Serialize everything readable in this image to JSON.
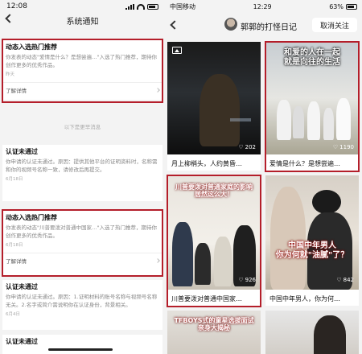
{
  "left": {
    "status_time": "12:08",
    "title": "系统通知",
    "more_text": "以下是更早消息",
    "cards": [
      {
        "title": "动态入选热门推荐",
        "body": "你发表的动态\"爱情是什么？是想尝遍…\"入选了热门推荐，期待你创作更多的优秀作品。",
        "date": "昨天",
        "link": "了解详情"
      },
      {
        "title": "认证未通过",
        "body": "你申请的认证未通过。原因：提供其他平台的证明资料时，名称需和你的视频号名称一致，请修改后再提交。",
        "date": "6月18日",
        "link": ""
      },
      {
        "title": "动态入选热门推荐",
        "body": "你发表的动态\"川普要泼对普通中国家…\"入选了热门推荐，期待你创作更多的优秀作品。",
        "date": "6月18日",
        "link": "了解详情"
      },
      {
        "title": "认证未通过",
        "body": "你申请的认证未通过。原因：1.证明材料的账号名称与视频号名称无关。2.名字或简介需说明你在认证身份，背景相关。",
        "date": "6月4日",
        "link": ""
      },
      {
        "title": "认证未通过",
        "body": "",
        "date": "",
        "link": ""
      }
    ]
  },
  "right": {
    "carrier": "中国移动",
    "status_time": "12:29",
    "battery": "63%",
    "account_name": "郭郭的打怪日记",
    "follow_button": "取消关注",
    "tiles": [
      {
        "caption": "月上柳梢头，人约黄昏…",
        "likes": "202",
        "overlay": ""
      },
      {
        "caption": "爱情是什么？是想尝遍…",
        "likes": "1190",
        "overlay": "和爱的人在一起\n就是向往的生活"
      },
      {
        "caption": "川普要泼对普通中国家…",
        "likes": "926",
        "overlay": "川普要泼对普通家庭的影响\n居然这么大！"
      },
      {
        "caption": "中国中年男人，你为何…",
        "likes": "842",
        "overlay": "中国中年男人\n你为何就\"油腻\"了？"
      },
      {
        "caption": "",
        "likes": "",
        "overlay": "TFBOYS式的童星选拔面试\n亲身大揭秘"
      },
      {
        "caption": "",
        "likes": "",
        "overlay": ""
      }
    ]
  },
  "colors": {
    "highlight_red": "#b41e2a",
    "page_bg": "#f3f3f3",
    "card_bg": "#ffffff"
  }
}
